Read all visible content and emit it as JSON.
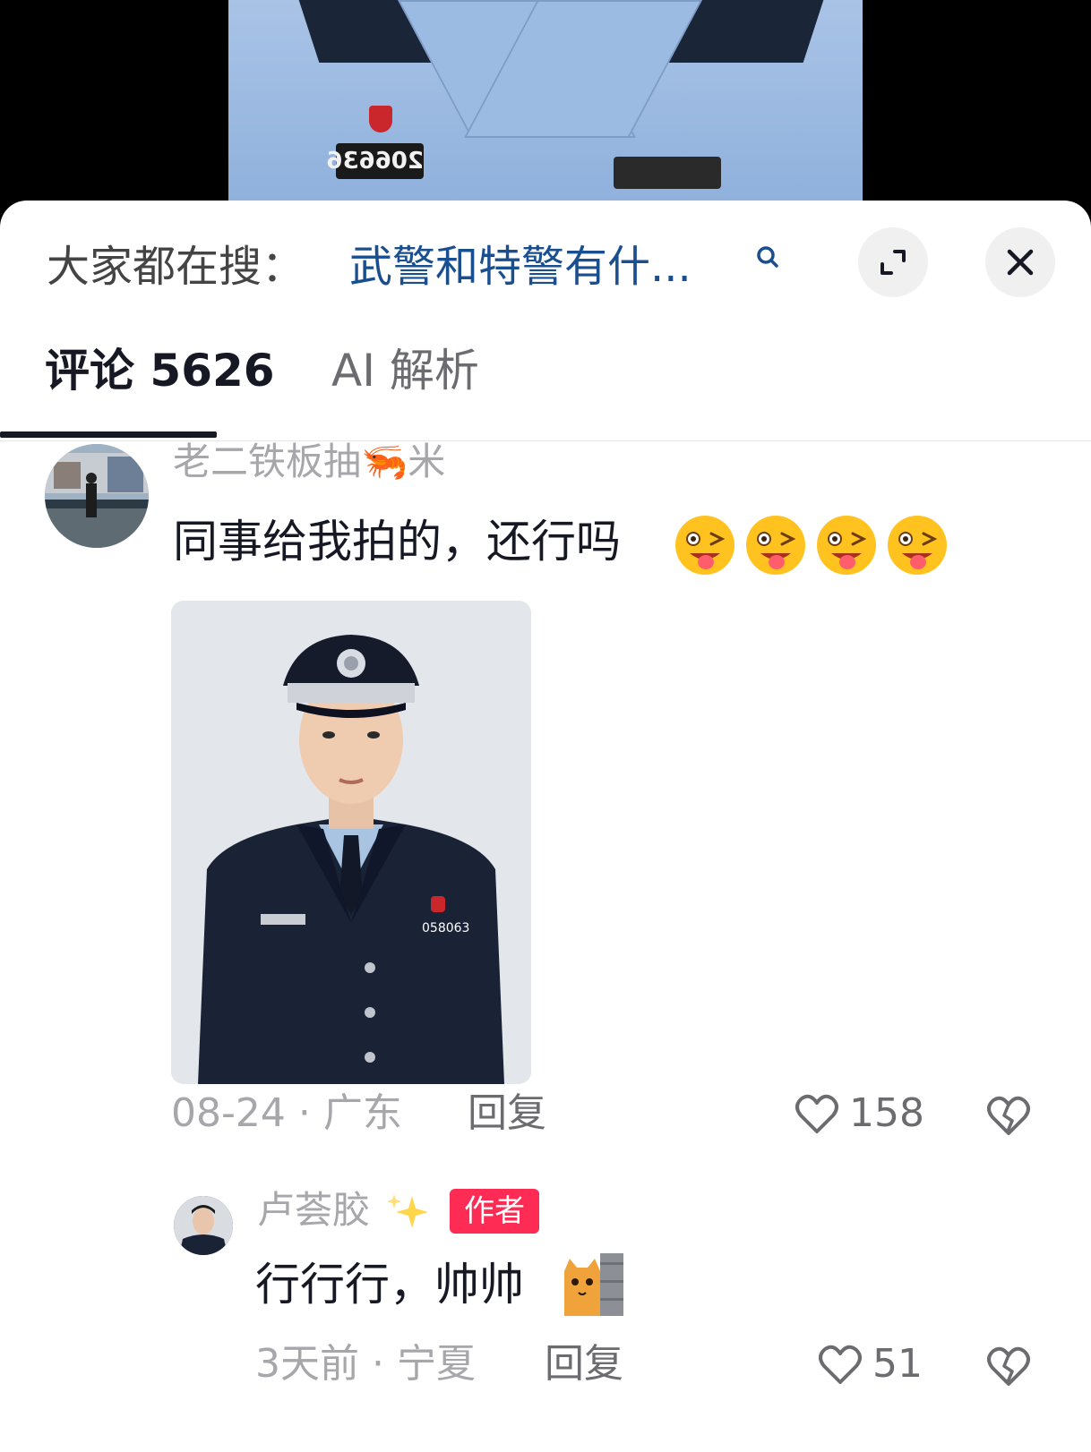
{
  "video": {
    "badge_number": "206636"
  },
  "search_bar": {
    "prefix": "大家都在搜：",
    "query": "武警和特警有什..."
  },
  "tabs": [
    {
      "label": "评论 5626",
      "active": true
    },
    {
      "label": "AI 解析",
      "active": false
    }
  ],
  "comments": [
    {
      "username": "老二铁板抽🦐米",
      "text": "同事给我拍的，还行吗",
      "emojis": [
        "wink-tongue",
        "wink-tongue",
        "wink-tongue",
        "wink-tongue"
      ],
      "photo_badge_number": "058063",
      "date": "08-24",
      "separator": "·",
      "location": "广东",
      "reply_label": "回复",
      "likes": "158"
    },
    {
      "username": "卢荟胶",
      "badge": "作者",
      "text": "行行行，帅帅",
      "date": "3天前",
      "separator": "·",
      "location": "宁夏",
      "reply_label": "回复",
      "likes": "51"
    }
  ],
  "colors": {
    "accent_link": "#1a4f8f",
    "author_badge": "#fe2c55",
    "primary_text": "#161823",
    "secondary_text": "#a6a6ab"
  }
}
